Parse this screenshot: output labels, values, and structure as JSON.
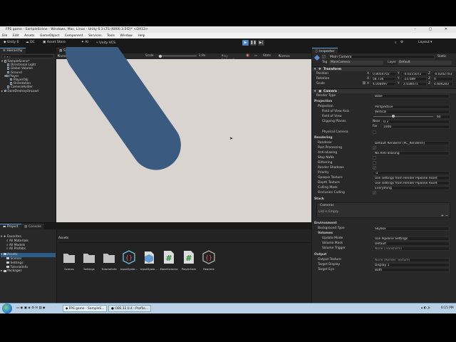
{
  "window": {
    "title": "FPS game - SampleScene - Windows, Mac, Linux - Unity 6.3 LTS (6000.3.5f2)* <DX12>",
    "controls": "–  ▢  ✕"
  },
  "menu": [
    "File",
    "Edit",
    "Assets",
    "GameObject",
    "Component",
    "Services",
    "Tools",
    "Window",
    "Help"
  ],
  "toolbar": {
    "account": "Unity 6",
    "dc": "DC",
    "store": "Asset Store",
    "ai": "AI",
    "vcs": "Unity VCS",
    "layout": "Layout"
  },
  "hierarchy": {
    "tab": "Hierarchy",
    "items": [
      "SampleScene*",
      "Directional Light",
      "Global Volume",
      "Ground",
      "Player",
      "PlayerObj",
      "Orientation",
      "CameraHolder",
      "DontDestroyOnLoad"
    ]
  },
  "game": {
    "tabs": [
      "Scene",
      "Game"
    ],
    "bar": {
      "mode": "Game",
      "display": "Display 1",
      "aspect": "Free Aspect",
      "scale_label": "Scale",
      "scale_value": "1.8x",
      "play": "Play Focused",
      "stats": "Stats",
      "gizmos": "Gizmos"
    }
  },
  "project": {
    "tabs": [
      "Project",
      "Console"
    ],
    "tree": {
      "favorites": "Favorites",
      "favorite_items": [
        "All Materials",
        "All Models",
        "All Prefabs"
      ],
      "assets": "Assets",
      "asset_items": [
        "Scenes",
        "Settings",
        "TutorialInfo"
      ],
      "packages": "Packages"
    },
    "breadcrumb": "Assets",
    "assets": [
      "Scenes",
      "Settings",
      "TutorialInfo",
      "InputSyste...",
      "InputSyste...",
      "MoveCamera",
      "PlayerCam",
      "Readme"
    ]
  },
  "inspector": {
    "tab": "Inspector",
    "object_name": "Main Camera",
    "static_label": "Static",
    "tag_label": "Tag",
    "tag_value": "MainCamera",
    "layer_label": "Layer",
    "layer_value": "Default",
    "transform": {
      "title": "Transform",
      "position_label": "Position",
      "position": [
        "0.8054702",
        "-0.0215072",
        "-0.0202703"
      ],
      "rotation_label": "Rotation",
      "rotation": [
        "58.736",
        "-23.089",
        "0"
      ],
      "scale_label": "Scale",
      "scale": [
        "4.058097",
        "2.038071",
        "4.604283"
      ]
    },
    "camera_title": "Camera",
    "render_type_label": "Render Type",
    "render_type": "Base",
    "projection_section": "Projection",
    "projection_label": "Projection",
    "projection": "Perspective",
    "fov_axis_label": "Field of View Axis",
    "fov_axis": "Vertical",
    "fov_label": "Field of View",
    "fov_value": "60",
    "clipping_label": "Clipping Planes",
    "near_label": "Near",
    "near": "0.3",
    "far_label": "Far",
    "far": "1000",
    "physical_label": "Physical Camera",
    "rendering_section": "Rendering",
    "renderer_label": "Renderer",
    "renderer": "Default Renderer (PC_Renderer)",
    "postproc_label": "Post Processing",
    "aa_label": "Anti-aliasing",
    "aa": "No Anti-aliasing",
    "stop_nans_label": "Stop NaNs",
    "dithering_label": "Dithering",
    "shadows_label": "Render Shadows",
    "priority_label": "Priority",
    "priority": "-1",
    "opaque_label": "Opaque Texture",
    "opaque": "Use settings from Render Pipeline Asset",
    "depth_label": "Depth Texture",
    "depth": "Use settings from Render Pipeline Asset",
    "culling_label": "Culling Mask",
    "culling": "Everything",
    "occlusion_label": "Occlusion Culling",
    "stack_section": "Stack",
    "cameras_label": "Cameras",
    "list_empty": "List is Empty",
    "environment_section": "Environment",
    "bg_type_label": "Background Type",
    "bg_type": "Skybox",
    "volumes_label": "Volumes",
    "update_mode_label": "Update Mode",
    "update_mode": "Use Pipeline Settings",
    "volume_mask_label": "Volume Mask",
    "volume_mask": "Default",
    "volume_trigger_label": "Volume Trigger",
    "volume_trigger": "None (Transform)",
    "output_section": "Output",
    "output_tex_label": "Output Texture",
    "output_tex": "None (Render Texture)",
    "target_display_label": "Target Display",
    "target_display": "Display 1",
    "target_eye_label": "Target Eye",
    "target_eye": "Both"
  },
  "taskbar": {
    "item1": "FPS game - SampleS...",
    "item2": "OBS 32.0.4 - Profile...",
    "time": "6:15 PM"
  }
}
